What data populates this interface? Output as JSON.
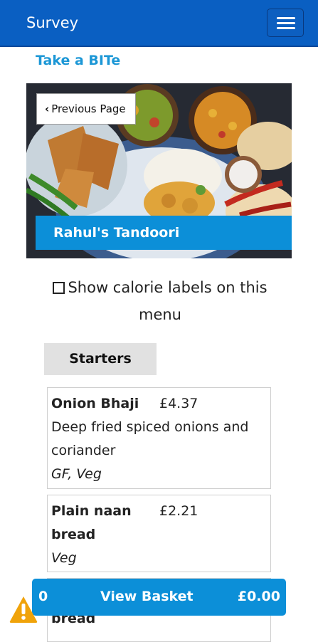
{
  "navbar": {
    "brand": "Survey",
    "menu_icon": "hamburger-icon"
  },
  "site": {
    "name": "Take a BITe"
  },
  "hero": {
    "back_label": "Previous Page",
    "back_icon": "chevron-left-icon",
    "restaurant_name": "Rahul's Tandoori"
  },
  "calorie_toggle": {
    "label": "Show calorie labels on this menu",
    "checked": false
  },
  "menu": {
    "section": "Starters",
    "items": [
      {
        "name": "Onion Bhaji",
        "price": "£4.37",
        "description": "Deep fried spiced onions and coriander",
        "tags": "GF, Veg"
      },
      {
        "name": "Plain naan bread",
        "price": "£2.21",
        "description": "",
        "tags": "Veg"
      },
      {
        "name": "bread",
        "price": "",
        "description": "",
        "tags": ""
      }
    ]
  },
  "basket": {
    "count": "0",
    "label": "View Basket",
    "total": "£0.00"
  },
  "alert": {
    "icon": "warning-icon",
    "color": "#f0a30a"
  },
  "colors": {
    "navbar": "#0a5fc2",
    "accent": "#0c8fd8",
    "link": "#1c97d6"
  }
}
